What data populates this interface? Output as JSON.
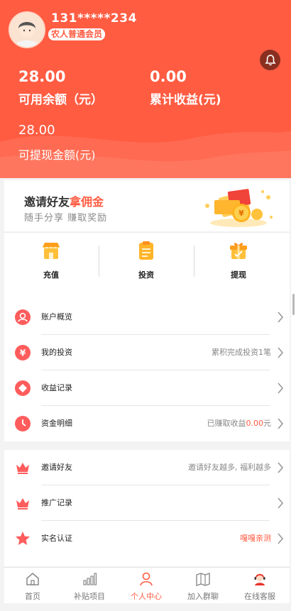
{
  "header": {
    "phone": "131*****234",
    "member_level": "农人普通会员",
    "available_balance": {
      "value": "28.00",
      "label": "可用余额（元）"
    },
    "total_earnings": {
      "value": "0.00",
      "label": "累计收益(元)"
    },
    "withdrawable": {
      "value": "28.00",
      "label": "可提现金额(元)"
    },
    "icons": {
      "avatar": "avatar-icon",
      "bell": "bell-icon"
    }
  },
  "invite_banner": {
    "title_main": "邀请好友",
    "title_highlight": "拿佣金",
    "subtitle": "随手分享  赚取奖励"
  },
  "quick_actions": [
    {
      "label": "充值",
      "icon": "shop-icon"
    },
    {
      "label": "投资",
      "icon": "clipboard-icon"
    },
    {
      "label": "提现",
      "icon": "gift-icon"
    }
  ],
  "menu_group_1": [
    {
      "label": "账户概览",
      "value": "",
      "icon": "user-circle-icon"
    },
    {
      "label": "我的投资",
      "value": "累积完成投资1笔",
      "icon": "yen-circle-icon"
    },
    {
      "label": "收益记录",
      "value": "",
      "icon": "diamond-circle-icon"
    },
    {
      "label": "资金明细",
      "value_prefix": "已赚取收益",
      "value_amount": "0.00",
      "value_suffix": "元",
      "icon": "clock-icon"
    }
  ],
  "menu_group_2": [
    {
      "label": "邀请好友",
      "value": "邀请好友越多, 福利越多",
      "icon": "crown-icon"
    },
    {
      "label": "推广记录",
      "value": "",
      "icon": "crown-icon"
    },
    {
      "label": "实名认证",
      "value": "嘎嘎亲测",
      "icon": "star-icon"
    }
  ],
  "tabbar": {
    "active": "个人中心",
    "items": [
      {
        "label": "首页",
        "icon": "home-icon"
      },
      {
        "label": "补贴项目",
        "icon": "bar-chart-icon"
      },
      {
        "label": "个人中心",
        "icon": "person-icon"
      },
      {
        "label": "加入群聊",
        "icon": "map-icon"
      },
      {
        "label": "在线客服",
        "icon": "support-agent-icon"
      }
    ]
  },
  "colors": {
    "accent": "#ff5c42",
    "header_bg": "#ff5c42",
    "page_bg": "#f3f3f3"
  }
}
